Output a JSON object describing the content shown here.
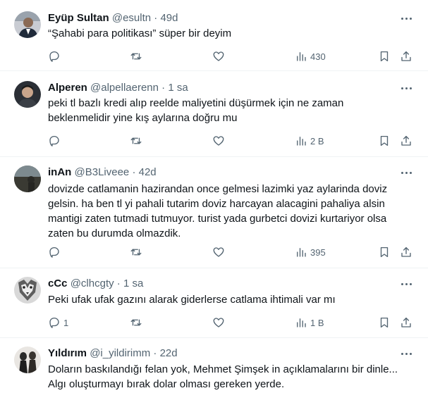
{
  "tweets": [
    {
      "name": "Eyüp Sultan",
      "handle": "@esultn",
      "sep": "·",
      "time": "49d",
      "text": "“Şahabi para politikası” süper bir deyim",
      "reply_count": "",
      "views": "430"
    },
    {
      "name": "Alperen",
      "handle": "@alpellaerenn",
      "sep": "·",
      "time": "1 sa",
      "text": "peki tl bazlı kredi alıp reelde maliyetini düşürmek için ne zaman\nbeklenmelidir yine kış aylarına doğru mu",
      "reply_count": "",
      "views": "2 B"
    },
    {
      "name": "inAn",
      "handle": "@B3Liveee",
      "sep": "·",
      "time": "42d",
      "text": "dovizde catlamanin hazirandan once gelmesi lazimki yaz aylarinda doviz\ngelsin. ha ben tl yi pahali tutarim doviz harcayan alacagini pahaliya alsin\nmantigi zaten tutmadi tutmuyor. turist yada gurbetci dovizi kurtariyor olsa\nzaten bu durumda olmazdik.",
      "reply_count": "",
      "views": "395"
    },
    {
      "name": "cCc",
      "handle": "@clhcgty",
      "sep": "·",
      "time": "1 sa",
      "text": "Peki ufak ufak gazını alarak giderlerse catlama ihtimali var mı",
      "reply_count": "1",
      "views": "1 B"
    },
    {
      "name": "Yıldırım",
      "handle": "@i_yildirimm",
      "sep": "·",
      "time": "22d",
      "text": "Doların baskılandığı felan yok, Mehmet Şimşek in açıklamalarını bir dinle...\nAlgı oluşturmayı bırak dolar olması gereken yerde.",
      "reply_count": "",
      "views": ""
    }
  ],
  "icons": {
    "reply": "reply-icon",
    "retweet": "retweet-icon",
    "like": "like-icon",
    "views": "views-icon",
    "bookmark": "bookmark-icon",
    "share": "share-icon",
    "more": "more-icon"
  },
  "colors": {
    "text": "#0f1419",
    "muted": "#536471",
    "divider": "#eff3f4"
  }
}
